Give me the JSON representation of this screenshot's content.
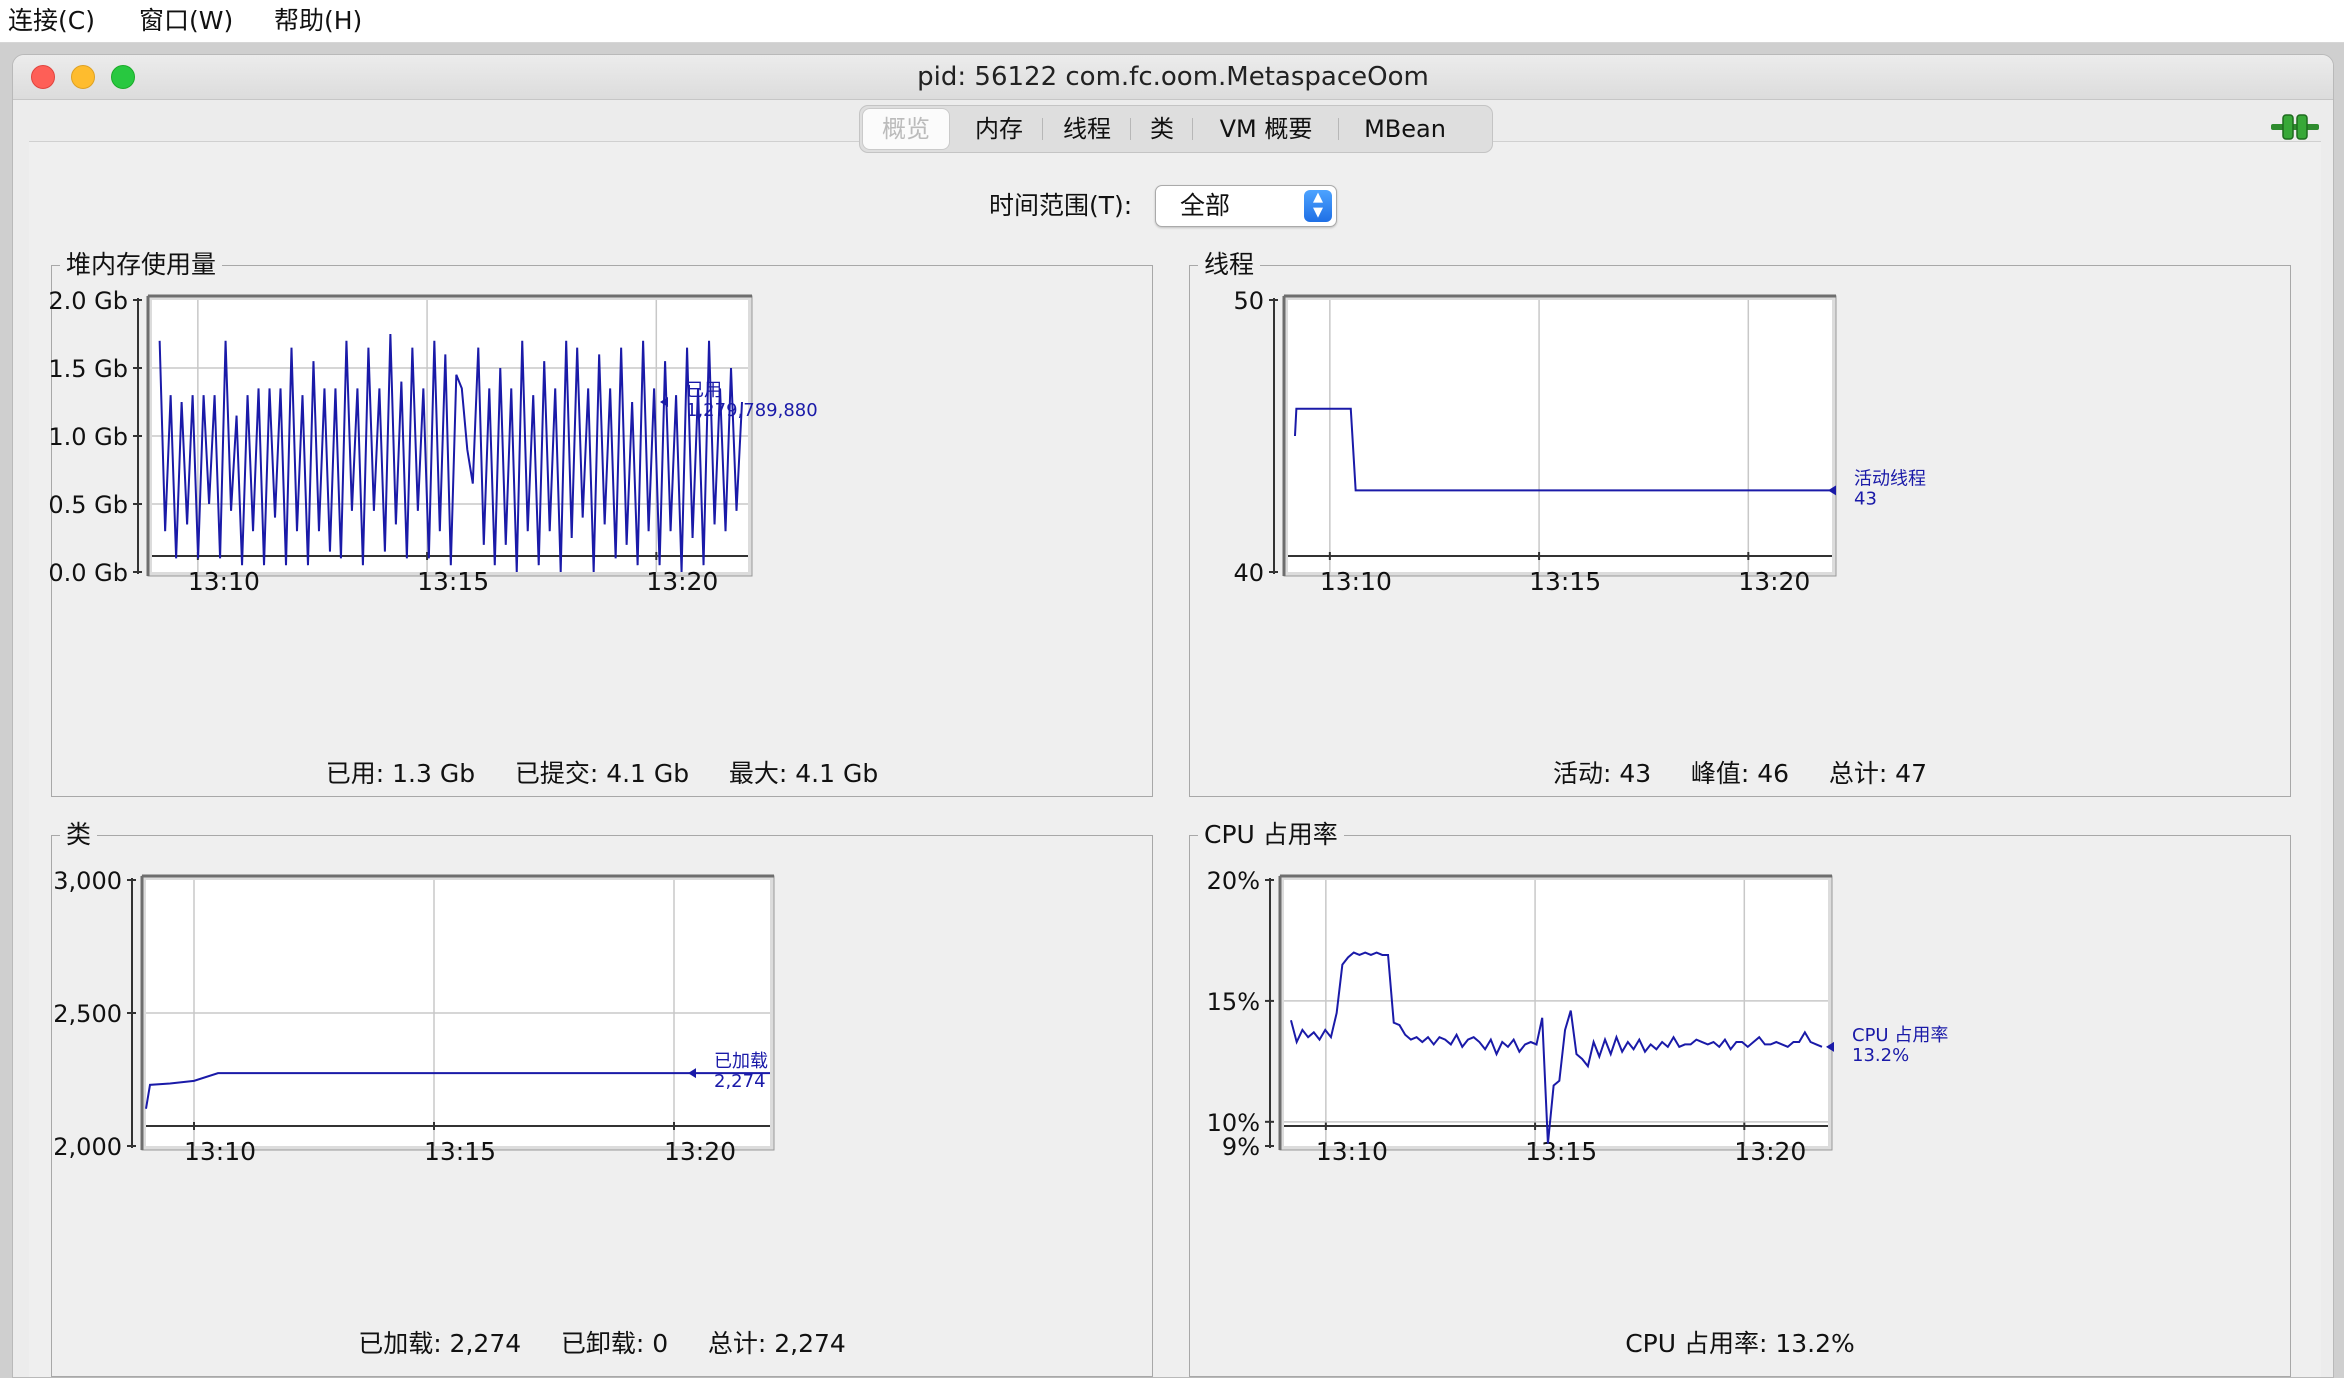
{
  "menubar": {
    "items": [
      "连接(C)",
      "窗口(W)",
      "帮助(H)"
    ]
  },
  "window": {
    "title": "pid: 56122 com.fc.oom.MetaspaceOom"
  },
  "tabs": [
    "概览",
    "内存",
    "线程",
    "类",
    "VM 概要",
    "MBean"
  ],
  "active_tab": "概览",
  "icons": {
    "connection": "connection-plug-icon",
    "select_arrows": "chevron-updown-icon"
  },
  "colors": {
    "series_line": "#1a1aa8",
    "plot_bg": "#ffffff",
    "grid": "#c8c8c8",
    "accent": "#2f7cf6"
  },
  "time_range": {
    "label": "时间范围(T):",
    "value": "全部"
  },
  "panels": [
    {
      "title": "堆内存使用量",
      "summary": "已用: 1.3 Gb     已提交: 4.1 Gb     最大: 4.1 Gb",
      "legend": {
        "name": "已用",
        "value": "1,279,789,880"
      }
    },
    {
      "title": "线程",
      "summary": "活动: 43     峰值: 46     总计: 47",
      "legend": {
        "name": "活动线程",
        "value": "43"
      }
    },
    {
      "title": "类",
      "summary": "已加载: 2,274     已卸载: 0     总计: 2,274",
      "legend": {
        "name": "已加载",
        "value": "2,274"
      }
    },
    {
      "title": "CPU 占用率",
      "summary": "CPU 占用率: 13.2%",
      "legend": {
        "name": "CPU 占用率",
        "value": "13.2%"
      }
    }
  ],
  "chart_data": [
    {
      "type": "line",
      "title": "堆内存使用量",
      "y_unit": "Gb",
      "x_range": [
        "13:09",
        "13:22"
      ],
      "x_ticks": [
        "13:10",
        "13:15",
        "13:20"
      ],
      "y_range": [
        0,
        2.0
      ],
      "y_ticks": [
        "0.0 Gb",
        "0.5 Gb",
        "1.0 Gb",
        "1.5 Gb",
        "2.0 Gb"
      ],
      "grid": true,
      "legend_position": "right",
      "series": [
        {
          "name": "已用",
          "values": [
            1.7,
            0.3,
            1.3,
            0.1,
            1.25,
            0.35,
            1.3,
            0.1,
            1.3,
            0.5,
            1.3,
            0.1,
            1.7,
            0.45,
            1.15,
            0.05,
            1.3,
            0.3,
            1.35,
            0.05,
            1.35,
            0.4,
            1.35,
            0.05,
            1.65,
            0.3,
            1.3,
            0.05,
            1.55,
            0.3,
            1.35,
            0.15,
            1.35,
            0.1,
            1.7,
            0.45,
            1.35,
            0.05,
            1.65,
            0.45,
            1.35,
            0.15,
            1.75,
            0.35,
            1.4,
            0.1,
            1.65,
            0.45,
            1.35,
            0.1,
            1.7,
            0.3,
            1.6,
            0.05,
            1.45,
            1.35,
            0.9,
            0.65,
            1.65,
            0.2,
            1.35,
            0.05,
            1.5,
            0.2,
            1.35,
            0.0,
            1.7,
            0.3,
            1.3,
            0.05,
            1.55,
            0.3,
            1.35,
            0.0,
            1.7,
            0.25,
            1.65,
            0.4,
            1.35,
            0.0,
            1.6,
            0.35,
            1.35,
            0.1,
            1.65,
            0.2,
            1.25,
            0.05,
            1.7,
            0.3,
            1.35,
            0.05,
            1.55,
            0.3,
            1.3,
            0.0,
            1.65,
            0.25,
            1.35,
            0.05,
            1.7,
            0.35,
            1.35,
            0.3,
            1.5,
            0.45,
            1.25
          ]
        }
      ]
    },
    {
      "type": "line",
      "title": "线程",
      "x_range": [
        "13:09",
        "13:22"
      ],
      "x_ticks": [
        "13:10",
        "13:15",
        "13:20"
      ],
      "y_range": [
        40,
        50
      ],
      "y_ticks": [
        "40",
        "50"
      ],
      "grid": true,
      "legend_position": "right",
      "series": [
        {
          "name": "活动线程",
          "x": [
            "13:09:10",
            "13:09:12",
            "13:10:30",
            "13:10:37",
            "13:22:00"
          ],
          "values": [
            45,
            46,
            46,
            43,
            43
          ]
        }
      ]
    },
    {
      "type": "line",
      "title": "类",
      "x_range": [
        "13:09",
        "13:22"
      ],
      "x_ticks": [
        "13:10",
        "13:15",
        "13:20"
      ],
      "y_range": [
        2000,
        3000
      ],
      "y_ticks": [
        "2,000",
        "2,500",
        "3,000"
      ],
      "grid": true,
      "legend_position": "right",
      "series": [
        {
          "name": "已加载",
          "x": [
            "13:09:00",
            "13:09:05",
            "13:09:30",
            "13:10:00",
            "13:10:30",
            "13:22:00"
          ],
          "values": [
            2140,
            2230,
            2235,
            2245,
            2274,
            2274
          ]
        }
      ]
    },
    {
      "type": "line",
      "title": "CPU 占用率",
      "y_unit": "%",
      "x_range": [
        "13:09",
        "13:22"
      ],
      "x_ticks": [
        "13:10",
        "13:15",
        "13:20"
      ],
      "y_range": [
        9,
        20
      ],
      "y_ticks": [
        "9%",
        "10%",
        "15%",
        "20%"
      ],
      "grid": true,
      "legend_position": "right",
      "series": [
        {
          "name": "CPU 占用率",
          "values": [
            14.2,
            13.3,
            13.8,
            13.5,
            13.7,
            13.4,
            13.8,
            13.5,
            14.5,
            16.5,
            16.8,
            17.0,
            16.9,
            17.0,
            16.9,
            17.0,
            16.9,
            16.9,
            14.1,
            14.0,
            13.6,
            13.4,
            13.5,
            13.3,
            13.5,
            13.2,
            13.5,
            13.4,
            13.2,
            13.6,
            13.1,
            13.4,
            13.5,
            13.3,
            13.0,
            13.4,
            12.8,
            13.3,
            13.1,
            13.4,
            12.9,
            13.2,
            13.3,
            13.2,
            14.3,
            9.1,
            11.5,
            11.7,
            13.8,
            14.6,
            12.8,
            12.6,
            12.3,
            13.3,
            12.7,
            13.4,
            12.8,
            13.5,
            12.9,
            13.3,
            13.0,
            13.4,
            12.9,
            13.2,
            13.0,
            13.3,
            13.1,
            13.5,
            13.1,
            13.2,
            13.2,
            13.4,
            13.3,
            13.2,
            13.3,
            13.1,
            13.4,
            13.0,
            13.3,
            13.3,
            13.1,
            13.3,
            13.5,
            13.2,
            13.2,
            13.3,
            13.2,
            13.1,
            13.3,
            13.3,
            13.7,
            13.3,
            13.2,
            13.1
          ]
        }
      ]
    }
  ]
}
